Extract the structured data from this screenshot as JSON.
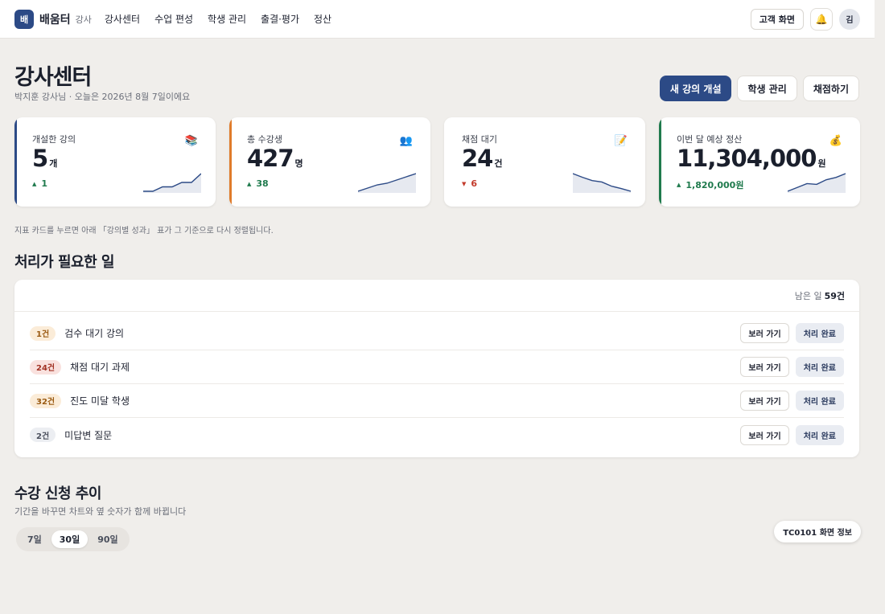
{
  "nav": {
    "logo_glyph": "배",
    "brand": "배움터",
    "role": "강사",
    "links": [
      "강사센터",
      "수업 편성",
      "학생 관리",
      "출결·평가",
      "정산"
    ],
    "customer_view": "고객 화면",
    "bell": "🔔",
    "avatar": "김"
  },
  "header": {
    "title": "강사센터",
    "subtitle": "박지훈 강사님 · 오늘은 2026년 8월 7일이에요",
    "actions": [
      "새 강의 개설",
      "학생 관리",
      "채점하기"
    ]
  },
  "kpis": [
    {
      "label": "개설한 강의",
      "value": "5",
      "unit": "개",
      "delta": "1",
      "direction": "up",
      "icon": "📚",
      "accent": "#2c4a86",
      "trend": [
        1,
        1,
        2,
        2,
        3,
        3,
        5
      ]
    },
    {
      "label": "총 수강생",
      "value": "427",
      "unit": "명",
      "delta": "38",
      "direction": "up",
      "icon": "👥",
      "accent": "#e07b2a",
      "trend": [
        1,
        2,
        3,
        3.5,
        4.5,
        5.5,
        6.5
      ]
    },
    {
      "label": "채점 대기",
      "value": "24",
      "unit": "건",
      "delta": "6",
      "direction": "down",
      "icon": "📝",
      "accent": "#ffffff",
      "trend": [
        6,
        5.2,
        4.5,
        4.2,
        3.3,
        2.8,
        2.2
      ]
    },
    {
      "label": "이번 달 예상 정산",
      "value": "11,304,000",
      "unit": "원",
      "delta": "1,820,000원",
      "direction": "up",
      "icon": "💰",
      "accent": "#1f7a4d",
      "trend": [
        1,
        2,
        3,
        2.8,
        4,
        4.6,
        5.6
      ]
    }
  ],
  "hint": "지표 카드를 누르면 아래 「강의별 성과」 표가 그 기준으로 다시 정렬됩니다.",
  "tasks": {
    "title": "처리가 필요한 일",
    "remaining_label": "남은 일",
    "remaining_count": "59건",
    "go_label": "보러 가기",
    "done_label": "처리 완료",
    "items": [
      {
        "count": "1건",
        "label": "검수 대기 강의",
        "tone": "orange"
      },
      {
        "count": "24건",
        "label": "채점 대기 과제",
        "tone": "red"
      },
      {
        "count": "32건",
        "label": "진도 미달 학생",
        "tone": "orange"
      },
      {
        "count": "2건",
        "label": "미답변 질문",
        "tone": "grey"
      }
    ]
  },
  "trend": {
    "title": "수강 신청 추이",
    "subtitle": "기간을 바꾸면 차트와 옆 숫자가 함께 바뀝니다",
    "periods": [
      "7일",
      "30일",
      "90일"
    ],
    "active_period": 1
  },
  "screen_info": "TC0101 화면 정보"
}
